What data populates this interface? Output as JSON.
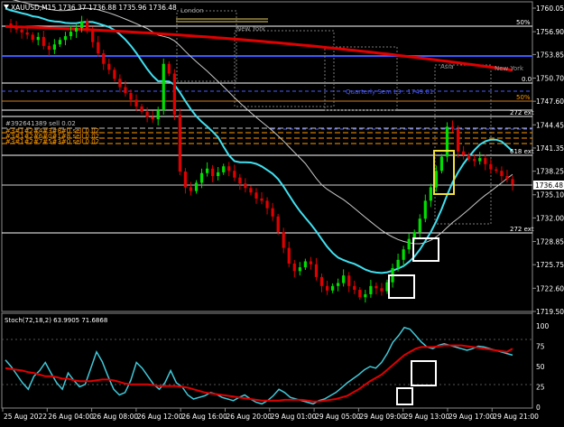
{
  "header": {
    "symbol_line": "XAUUSD,M15  1736.37 1736.88 1735.96 1736.48"
  },
  "price_panel": {
    "axis_labels": [
      "1760.05",
      "1756.90",
      "1753.85",
      "1750.70",
      "1747.60",
      "1744.45",
      "1741.35",
      "1738.25",
      "1735.10",
      "1732.00",
      "1728.85",
      "1725.75",
      "1722.60",
      "1719.50"
    ],
    "current_price": "1736.48",
    "session_labels": [
      {
        "text": "London",
        "color": "#9a9a9a"
      },
      {
        "text": "New York",
        "color": "#9a9a9a"
      },
      {
        "text": "Asia",
        "color": "#9a9a9a"
      },
      {
        "text": "New York",
        "color": "#9a9a9a"
      }
    ],
    "level_labels": [
      {
        "text": "50%",
        "color": "#ffffff"
      },
      {
        "text": "0.0",
        "color": "#ffffff"
      },
      {
        "text": "50%",
        "color": "#ff9900"
      },
      {
        "text": "272 ext",
        "color": "#ffffff"
      },
      {
        "text": "618 ext",
        "color": "#ffffff"
      },
      {
        "text": "272 ext",
        "color": "#ffffff"
      }
    ],
    "quarterly_label": {
      "text": "Quarterly Sem L3 : 1749.01",
      "color": "#4a5aff"
    },
    "order_lines": [
      {
        "text": "#392641389 sell 0.02",
        "color": "#c0c0c0"
      },
      {
        "text": "#3#1#2#4#3#8#0 sell 0.02",
        "color": "#ff9900"
      },
      {
        "text": "#3#1#2#6#0#1#8 sell 0.02",
        "color": "#ff9900"
      },
      {
        "text": "#3#1#2#7#5#3#0 sell 0.02",
        "color": "#ff9900"
      }
    ]
  },
  "stoch_panel": {
    "title": "Stoch(72,18,2) 63.9905 71.6868",
    "axis_labels": [
      "100",
      "75",
      "50",
      "25",
      "0"
    ]
  },
  "time_axis": {
    "labels": [
      "25 Aug 2022",
      "26 Aug 04:00",
      "26 Aug 08:00",
      "26 Aug 12:00",
      "26 Aug 16:00",
      "26 Aug 20:00",
      "29 Aug 01:00",
      "29 Aug 05:00",
      "29 Aug 09:00",
      "29 Aug 13:00",
      "29 Aug 17:00",
      "29 Aug 21:00"
    ]
  },
  "colors": {
    "background": "#000000",
    "bull": "#00e000",
    "bear": "#e00000",
    "ma_red": "#e00000",
    "ma_cyan": "#40e0f0",
    "ma_white": "#c8c8c8",
    "stoch_main": "#40c8d8",
    "stoch_signal": "#e00000",
    "box_white": "#ffffff",
    "box_yellow": "#f0e040"
  },
  "chart_data": {
    "type": "candlestick",
    "symbol": "XAUUSD",
    "timeframe": "M15",
    "ylim": [
      1719.5,
      1760.05
    ],
    "ohlc": [
      1736.37,
      1736.88,
      1735.96,
      1736.48
    ],
    "close_path": [
      1758.0,
      1757.5,
      1757.2,
      1756.8,
      1756.5,
      1755.8,
      1756.2,
      1755.0,
      1754.5,
      1755.2,
      1755.8,
      1756.3,
      1756.9,
      1757.4,
      1758.3,
      1757.0,
      1755.5,
      1754.0,
      1752.6,
      1751.8,
      1750.6,
      1749.5,
      1748.7,
      1747.8,
      1746.9,
      1746.2,
      1745.5,
      1745.2,
      1746.4,
      1752.6,
      1751.3,
      1745.8,
      1738.2,
      1736.1,
      1735.6,
      1736.7,
      1738.0,
      1738.6,
      1737.6,
      1738.1,
      1738.9,
      1738.3,
      1737.4,
      1736.6,
      1736.0,
      1735.4,
      1734.6,
      1734.3,
      1733.3,
      1732.2,
      1730.1,
      1728.0,
      1725.9,
      1724.9,
      1725.4,
      1726.2,
      1725.8,
      1724.1,
      1722.9,
      1722.3,
      1722.9,
      1723.3,
      1724.3,
      1722.9,
      1722.4,
      1721.4,
      1721.8,
      1722.9,
      1722.6,
      1722.2,
      1723.4,
      1725.3,
      1726.4,
      1727.8,
      1729.2,
      1730.1,
      1731.9,
      1734.3,
      1736.1,
      1738.3,
      1740.2,
      1744.2,
      1743.9,
      1740.9,
      1740.4,
      1739.9,
      1739.6,
      1740.0,
      1739.2,
      1738.5,
      1738.3,
      1737.6,
      1737.2,
      1736.48
    ],
    "stoch_main": [
      58,
      50,
      40,
      30,
      22,
      38,
      45,
      55,
      42,
      30,
      22,
      42,
      33,
      25,
      28,
      48,
      68,
      56,
      38,
      22,
      15,
      18,
      33,
      55,
      48,
      38,
      28,
      22,
      30,
      45,
      30,
      25,
      15,
      10,
      12,
      14,
      18,
      16,
      12,
      10,
      8,
      12,
      15,
      10,
      6,
      4,
      8,
      14,
      22,
      18,
      12,
      10,
      8,
      6,
      4,
      8,
      10,
      14,
      18,
      24,
      30,
      35,
      40,
      46,
      50,
      48,
      55,
      66,
      80,
      88,
      98,
      96,
      88,
      80,
      74,
      72,
      76,
      78,
      76,
      74,
      72,
      70,
      72,
      75,
      74,
      72,
      70,
      68,
      66,
      64
    ],
    "stoch_signal": [
      48,
      47,
      46,
      45,
      43,
      42,
      40,
      38,
      38,
      37,
      35,
      35,
      33,
      32,
      32,
      32,
      33,
      34,
      34,
      33,
      31,
      29,
      28,
      28,
      28,
      28,
      27,
      26,
      26,
      26,
      26,
      25,
      24,
      22,
      20,
      18,
      17,
      16,
      15,
      14,
      13,
      12,
      11,
      10,
      9,
      8,
      8,
      8,
      8,
      9,
      9,
      9,
      9,
      8,
      7,
      7,
      8,
      9,
      10,
      12,
      14,
      18,
      22,
      27,
      32,
      36,
      40,
      46,
      52,
      58,
      64,
      68,
      72,
      74,
      74,
      74,
      75,
      76,
      76,
      76,
      76,
      75,
      74,
      73,
      72,
      71,
      70,
      69,
      68,
      72
    ],
    "grid": false
  }
}
